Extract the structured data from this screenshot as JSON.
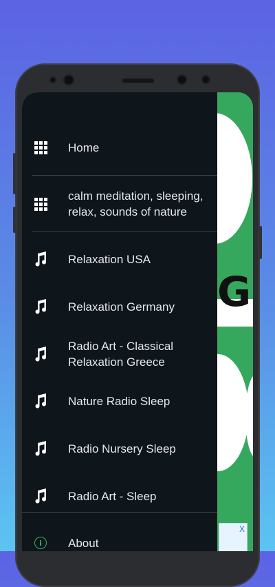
{
  "menu": {
    "items": [
      {
        "label": "Home",
        "icon": "grid-icon"
      },
      {
        "label": "calm meditation, sleeping, relax, sounds of nature",
        "icon": "grid-icon"
      },
      {
        "label": "Relaxation USA",
        "icon": "music-note-icon"
      },
      {
        "label": "Relaxation Germany",
        "icon": "music-note-icon"
      },
      {
        "label": "Radio Art - Classical Relaxation Greece",
        "icon": "music-note-icon"
      },
      {
        "label": "Nature Radio Sleep",
        "icon": "music-note-icon"
      },
      {
        "label": "Radio Nursery Sleep",
        "icon": "music-note-icon"
      },
      {
        "label": "Radio Art - Sleep",
        "icon": "music-note-icon"
      },
      {
        "label": "About",
        "icon": "info-icon"
      }
    ]
  },
  "background_app": {
    "visible_letter": "G",
    "ad_close": "X"
  },
  "colors": {
    "drawer_bg": "#0e151b",
    "text": "#e6e8ea",
    "accent": "#2eb867",
    "page_gradient_top": "#5c63e4",
    "page_gradient_bottom": "#5bc4f2"
  }
}
